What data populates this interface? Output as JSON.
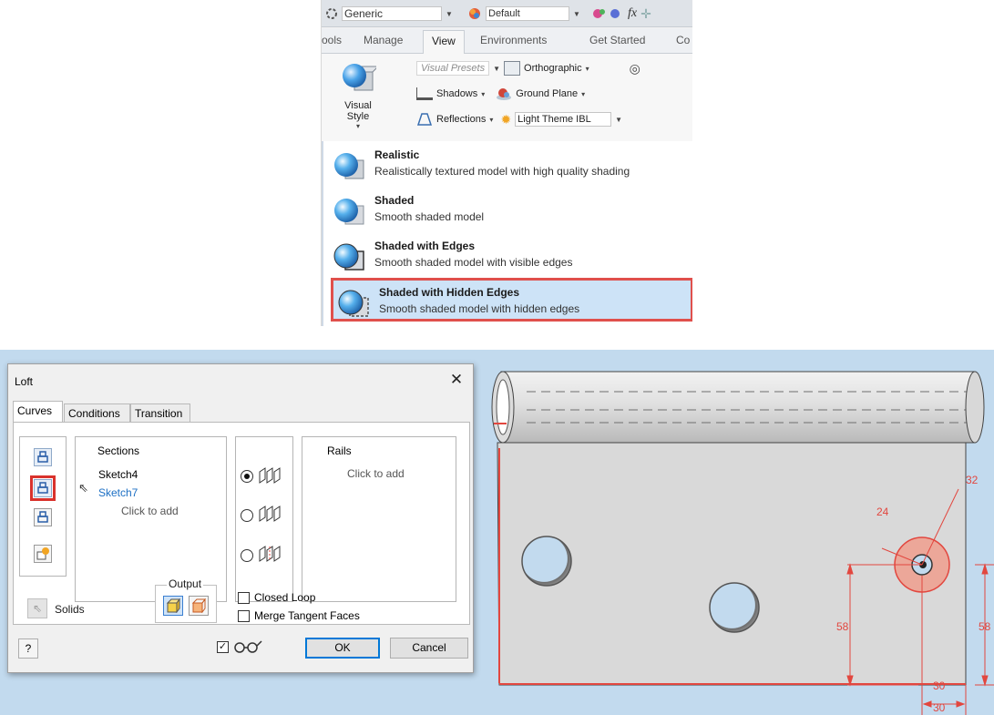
{
  "ribbon": {
    "quick_access": {
      "material": "Generic",
      "appearance": "Default",
      "fx": "fx"
    },
    "tabs": [
      "ools",
      "Manage",
      "View",
      "Environments",
      "Get Started",
      "Co"
    ],
    "active_tab": "View",
    "visual_style_label": "Visual Style",
    "visual_presets": "Visual Presets",
    "orthographic": "Orthographic",
    "shadows": "Shadows",
    "ground_plane": "Ground Plane",
    "reflections": "Reflections",
    "light_theme": "Light Theme IBL",
    "visual_styles": [
      {
        "title": "Realistic",
        "desc": "Realistically textured model with high quality shading"
      },
      {
        "title": "Shaded",
        "desc": "Smooth shaded model"
      },
      {
        "title": "Shaded with Edges",
        "desc": "Smooth shaded model with visible edges"
      },
      {
        "title": "Shaded with Hidden Edges",
        "desc": "Smooth shaded model with hidden edges"
      }
    ],
    "selected_style": "Shaded with Hidden Edges",
    "colors": {
      "highlight_border": "#e0504c",
      "selected_bg": "#cde3f7"
    }
  },
  "loft_dialog": {
    "title": "Loft",
    "close": "✕",
    "tabs": [
      "Curves",
      "Conditions",
      "Transition"
    ],
    "active_tab": "Curves",
    "sections": {
      "header": "Sections",
      "items": [
        "Sketch4",
        "Sketch7"
      ],
      "hint": "Click to add"
    },
    "rails": {
      "header": "Rails",
      "hint": "Click to add"
    },
    "output": {
      "label": "Output"
    },
    "solids_label": "Solids",
    "closed_loop": {
      "label": "Closed Loop",
      "checked": false
    },
    "merge_tangent": {
      "label": "Merge Tangent Faces",
      "checked": false
    },
    "help": "?",
    "ok": "OK",
    "cancel": "Cancel"
  },
  "viewport": {
    "dimensions": [
      "32",
      "24",
      "58",
      "58",
      "30",
      "30"
    ],
    "colors": {
      "dimension": "#e2473f",
      "background": "#c2daee"
    }
  }
}
